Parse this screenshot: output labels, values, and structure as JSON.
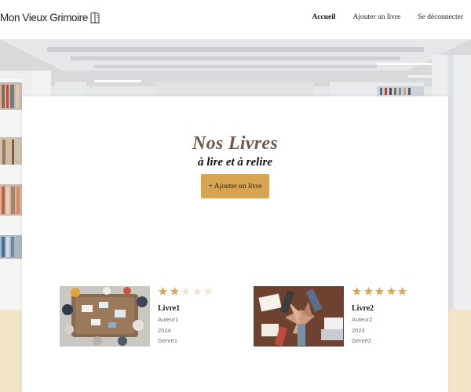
{
  "header": {
    "logo_text": "Mon Vieux Grimoire",
    "nav": [
      {
        "label": "Accueil",
        "active": true
      },
      {
        "label": "Ajouter un livre",
        "active": false
      },
      {
        "label": "Se déconnecter",
        "active": false
      }
    ]
  },
  "main": {
    "title": "Nos Livres",
    "subtitle": "à lire et à relire",
    "add_button": "+ Ajouter un livre"
  },
  "books": [
    {
      "title": "Livre1",
      "author": "Auteur1",
      "year": "2024",
      "genre": "Genre1",
      "rating": 2,
      "max_rating": 5
    },
    {
      "title": "Livre2",
      "author": "Auteur2",
      "year": "2023",
      "genre": "Genre2",
      "rating": 5,
      "max_rating": 5
    }
  ],
  "colors": {
    "accent": "#d7a551",
    "star_filled": "#d6ab60",
    "star_empty": "#efe6d3",
    "title": "#6b5a4a",
    "band": "#f3e6c8"
  }
}
